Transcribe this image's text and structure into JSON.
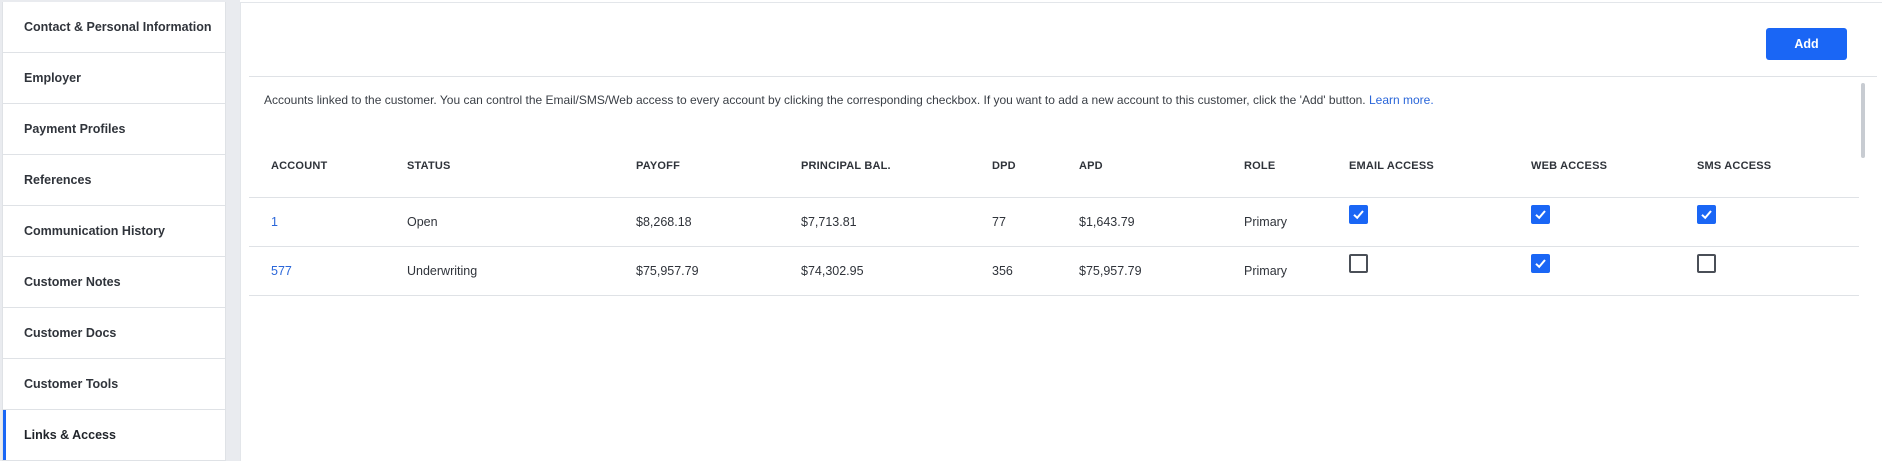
{
  "sidebar": {
    "items": [
      {
        "label": "Contact & Personal Information"
      },
      {
        "label": "Employer"
      },
      {
        "label": "Payment Profiles"
      },
      {
        "label": "References"
      },
      {
        "label": "Communication History"
      },
      {
        "label": "Customer Notes"
      },
      {
        "label": "Customer Docs"
      },
      {
        "label": "Customer Tools"
      },
      {
        "label": "Links & Access"
      }
    ],
    "active": "Links & Access"
  },
  "toolbar": {
    "add_label": "Add"
  },
  "info": {
    "text": "Accounts linked to the customer. You can control the Email/SMS/Web access to every account by clicking the corresponding checkbox. If you want to add a new account to this customer, click the 'Add' button.",
    "learn_more": "Learn more."
  },
  "table": {
    "headers": [
      "ACCOUNT",
      "STATUS",
      "PAYOFF",
      "PRINCIPAL BAL.",
      "DPD",
      "APD",
      "ROLE",
      "EMAIL ACCESS",
      "WEB ACCESS",
      "SMS ACCESS"
    ],
    "rows": [
      {
        "account": "1",
        "status": "Open",
        "payoff": "$8,268.18",
        "principal": "$7,713.81",
        "dpd": "77",
        "apd": "$1,643.79",
        "role": "Primary",
        "email": true,
        "web": true,
        "sms": true
      },
      {
        "account": "577",
        "status": "Underwriting",
        "payoff": "$75,957.79",
        "principal": "$74,302.95",
        "dpd": "356",
        "apd": "$75,957.79",
        "role": "Primary",
        "email": false,
        "web": true,
        "sms": false
      }
    ]
  },
  "colors": {
    "accent": "#1a66f5",
    "link": "#2a66d9"
  }
}
